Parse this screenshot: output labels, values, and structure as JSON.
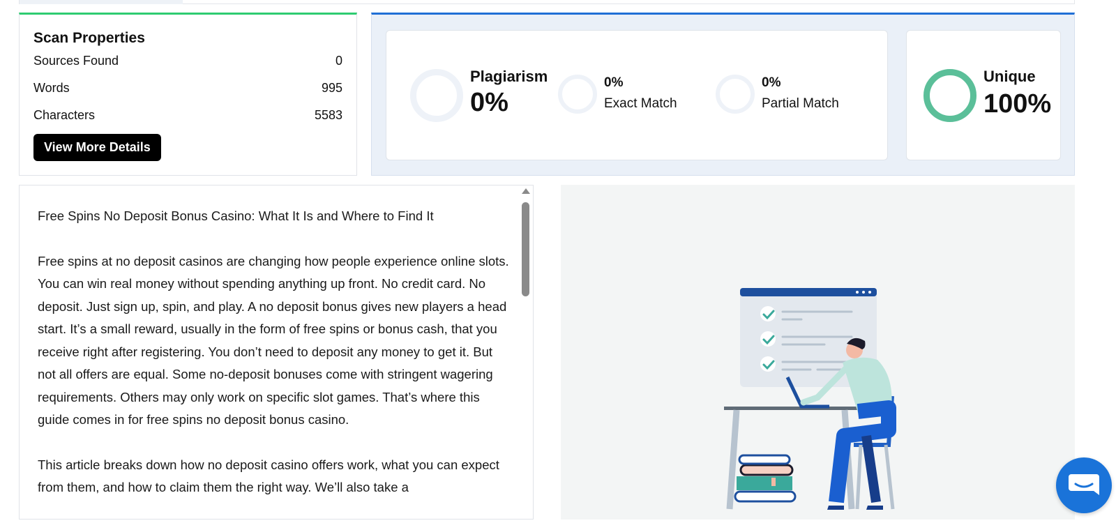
{
  "scan_properties": {
    "title": "Scan Properties",
    "rows": [
      {
        "label": "Sources Found",
        "value": "0"
      },
      {
        "label": "Words",
        "value": "995"
      },
      {
        "label": "Characters",
        "value": "5583"
      }
    ],
    "details_button": "View More Details"
  },
  "results": {
    "plagiarism": {
      "label": "Plagiarism",
      "value": "0%"
    },
    "exact_match": {
      "label": "Exact Match",
      "value": "0%"
    },
    "partial_match": {
      "label": "Partial Match",
      "value": "0%"
    },
    "unique": {
      "label": "Unique",
      "value": "100%",
      "fraction": 1.0
    },
    "colors": {
      "unique_ring": "#5bbf99",
      "empty_ring": "#eef2f8",
      "accent_green": "#2ecc71",
      "accent_blue": "#1f6fd6"
    }
  },
  "document": {
    "paragraphs": [
      "Free Spins No Deposit Bonus Casino: What It Is and Where to Find It",
      "Free spins at no deposit casinos are changing how people experience online slots. You can win real money without spending anything up front. No credit card. No deposit. Just sign up, spin, and play. A no deposit bonus gives new players a head start. It’s a small reward, usually in the form of free spins or bonus cash, that you receive right after registering. You don’t need to deposit any money to get it.  But not all offers are equal. Some no-deposit bonuses come with stringent wagering requirements. Others may only work on specific slot games. That’s where this guide comes in for free spins no deposit bonus casino.",
      "This article breaks down how no deposit casino offers work, what you can expect from them, and how to claim them the right way. We’ll also take a"
    ]
  },
  "icons": {
    "illustration": "person-at-laptop-checklist-illustration",
    "chat": "chat-bubble-icon"
  }
}
